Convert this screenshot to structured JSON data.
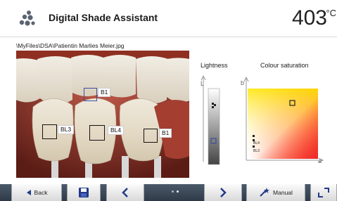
{
  "header": {
    "title": "Digital Shade Assistant",
    "temperature": "403",
    "temp_unit": "°C",
    "icon": "dental-app-icon"
  },
  "file": {
    "path": "\\MyFiles\\DSA\\Patientin Marlies Meier.jpg"
  },
  "photo": {
    "regions": [
      {
        "label": "B1",
        "selected": true
      },
      {
        "label": "BL3"
      },
      {
        "label": "BL4"
      },
      {
        "label": "B1"
      }
    ]
  },
  "lightness": {
    "title": "Lightness",
    "axis": "L",
    "markers": [
      "B1",
      "BL4",
      "BL3"
    ]
  },
  "saturation": {
    "title": "Colour saturation",
    "y_axis": "b",
    "x_axis": "a",
    "markers": [
      "B1",
      "BL4",
      "BL3"
    ]
  },
  "nav": {
    "back_label": "Back",
    "manual_label": "Manual",
    "page_indicator": {
      "pages": 2,
      "active": 1
    }
  },
  "colors": {
    "accent": "#3b4f9c",
    "bar": "#3a4756"
  }
}
